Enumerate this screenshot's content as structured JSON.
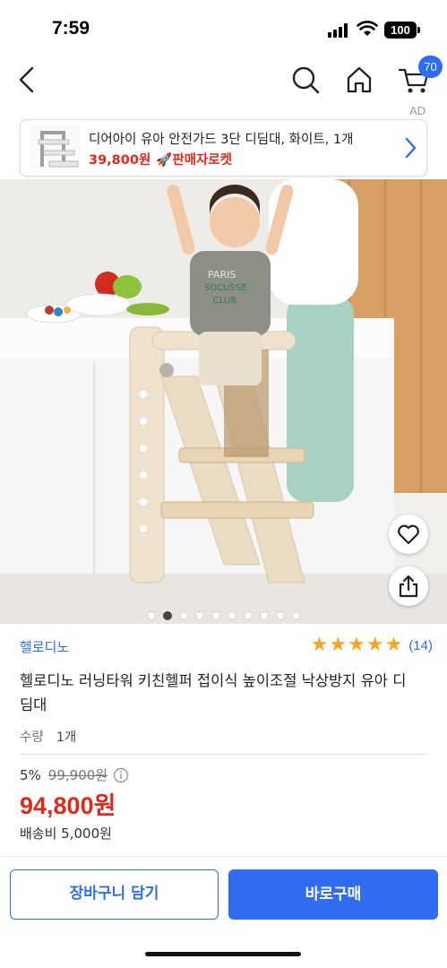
{
  "status_bar": {
    "time": "7:59",
    "battery": "100"
  },
  "nav": {
    "back_icon": "chevron-left-icon",
    "search_icon": "search-icon",
    "home_icon": "home-icon",
    "cart_icon": "cart-icon",
    "cart_badge": "70"
  },
  "ad": {
    "label": "AD",
    "title": "디어아이 유아 안전가드 3단 디딤대, 화이트, 1개",
    "price": "39,800원",
    "badge": "🚀판매자로켓"
  },
  "gallery": {
    "total_images": 10,
    "active_index": 1
  },
  "product": {
    "brand": "헬로디노",
    "rating": 5,
    "review_count": "(14)",
    "title": "헬로디노 러닝타워 키친헬퍼 접이식 높이조절 낙상방지 유아 디딤대",
    "qty_label": "수량",
    "qty_value": "1개",
    "discount_rate": "5%",
    "original_price": "99,900원",
    "sale_price": "94,800원",
    "shipping": "배송비 5,000원"
  },
  "actions": {
    "cart": "장바구니 담기",
    "buy": "바로구매"
  },
  "colors": {
    "accent": "#2f6cf0",
    "price_red": "#e0291d",
    "star": "#f5a623"
  }
}
